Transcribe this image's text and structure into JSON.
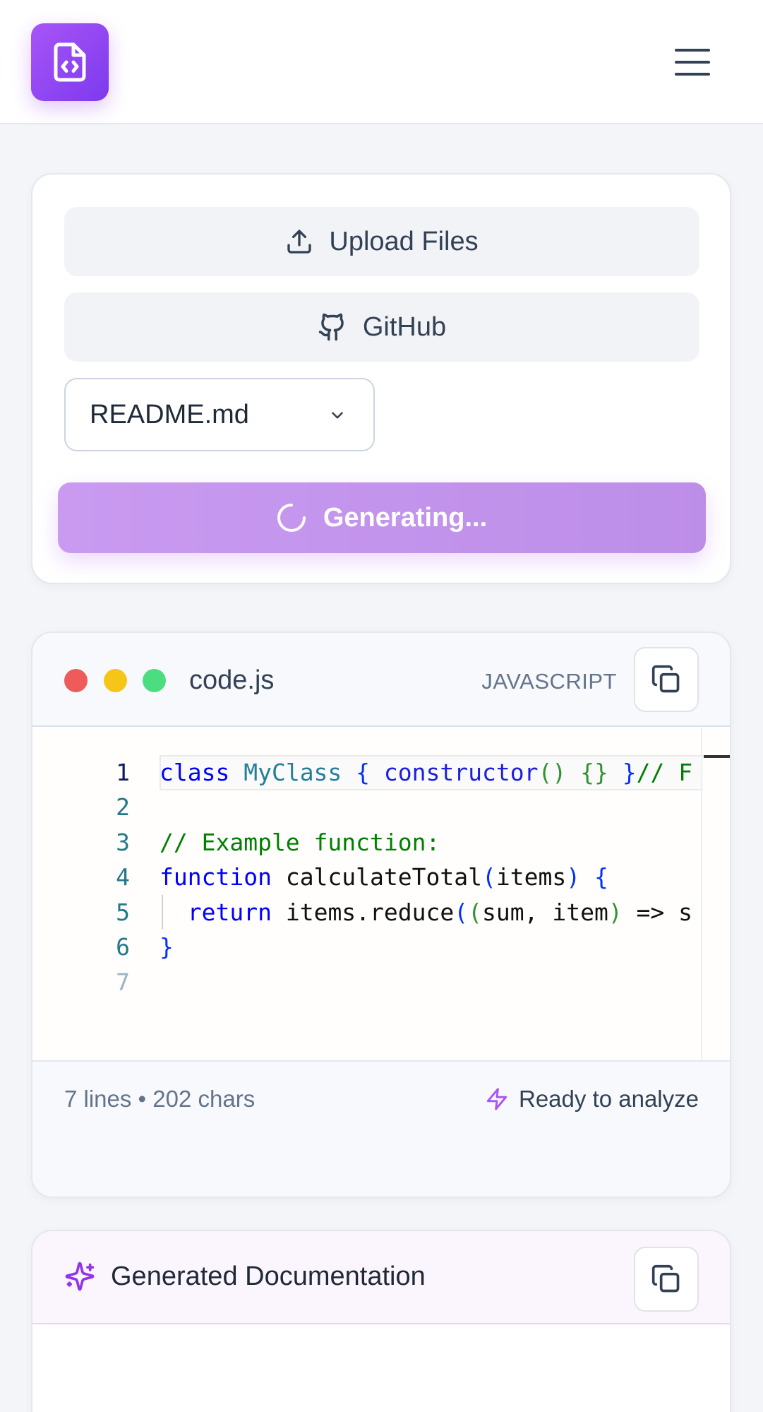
{
  "header": {
    "logo_icon": "file-code-icon",
    "menu_icon": "hamburger-menu-icon"
  },
  "input_panel": {
    "upload_label": "Upload Files",
    "github_label": "GitHub",
    "file_select_value": "README.md",
    "generate_label": "Generating...",
    "generate_state": "loading"
  },
  "code_panel": {
    "filename": "code.js",
    "language": "JAVASCRIPT",
    "line_numbers": [
      "1",
      "2",
      "3",
      "4",
      "5",
      "6",
      "7"
    ],
    "lines": [
      "class MyClass { constructor() {} }// F",
      "",
      "// Example function:",
      "function calculateTotal(items) {",
      "  return items.reduce((sum, item) => s",
      "}",
      ""
    ],
    "stats": "7 lines • 202 chars",
    "status": "Ready to analyze"
  },
  "docs_panel": {
    "title": "Generated Documentation"
  },
  "colors": {
    "accent": "#9333ea",
    "generate_bg": "#c99af0",
    "dot_red": "#ef5b5b",
    "dot_yellow": "#f5c518",
    "dot_green": "#4ade80"
  }
}
